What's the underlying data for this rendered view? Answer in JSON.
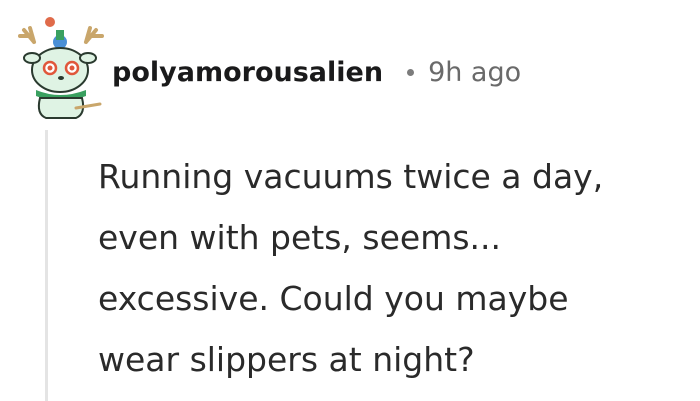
{
  "comment": {
    "author": "polyamorousalien",
    "separator": "•",
    "timestamp": "9h ago",
    "body_lines": [
      "Running vacuums twice a day,",
      "even with pets, seems...",
      "excessive. Could you maybe",
      "wear slippers at night?"
    ]
  },
  "avatar": {
    "icon": "reindeer-avatar-icon",
    "colors": {
      "face": "#dff3e4",
      "antler": "#c9a66b",
      "scarf": "#3aa060",
      "eye": "#e0573b",
      "hat": "#4a8fd6"
    }
  },
  "colors": {
    "username": "#1a1a1b",
    "timestamp": "#6a6a6a",
    "body": "#2a2a2a",
    "thread_line": "#e4e4e4"
  }
}
